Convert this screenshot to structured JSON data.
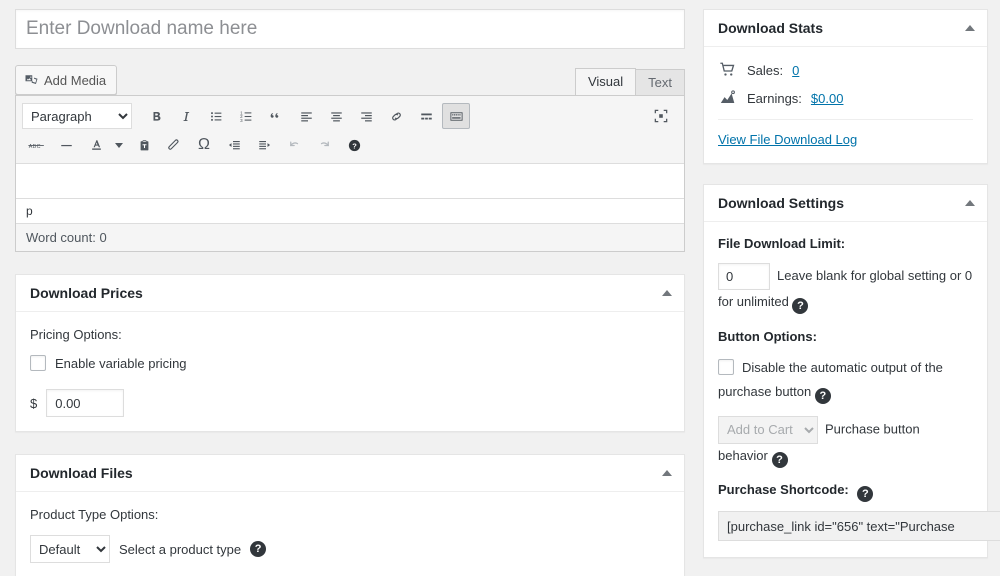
{
  "editor": {
    "title_placeholder": "Enter Download name here",
    "add_media_label": "Add Media",
    "tabs": [
      {
        "label": "Visual",
        "active": true
      },
      {
        "label": "Text",
        "active": false
      }
    ],
    "format_select": "Paragraph",
    "toolbar_row1": [
      {
        "name": "bold-icon",
        "title": "Bold"
      },
      {
        "name": "italic-icon",
        "title": "Italic"
      },
      {
        "name": "bulleted-list-icon",
        "title": "Bulleted list"
      },
      {
        "name": "numbered-list-icon",
        "title": "Numbered list"
      },
      {
        "name": "blockquote-icon",
        "title": "Blockquote"
      },
      {
        "name": "align-left-icon",
        "title": "Align left"
      },
      {
        "name": "align-center-icon",
        "title": "Align center"
      },
      {
        "name": "align-right-icon",
        "title": "Align right"
      },
      {
        "name": "link-icon",
        "title": "Insert/edit link"
      },
      {
        "name": "read-more-icon",
        "title": "Insert Read More tag"
      },
      {
        "name": "toolbar-toggle-icon",
        "title": "Toolbar Toggle"
      }
    ],
    "toolbar_row2": [
      {
        "name": "strikethrough-icon",
        "title": "Strikethrough"
      },
      {
        "name": "horizontal-rule-icon",
        "title": "Horizontal line"
      },
      {
        "name": "text-color-icon",
        "title": "Text color"
      },
      {
        "name": "text-color-caret-icon",
        "title": "Text color options"
      },
      {
        "name": "paste-as-text-icon",
        "title": "Paste as text"
      },
      {
        "name": "clear-formatting-icon",
        "title": "Clear formatting"
      },
      {
        "name": "special-character-icon",
        "title": "Special character"
      },
      {
        "name": "outdent-icon",
        "title": "Decrease indent"
      },
      {
        "name": "indent-icon",
        "title": "Increase indent"
      },
      {
        "name": "undo-icon",
        "title": "Undo"
      },
      {
        "name": "redo-icon",
        "title": "Redo"
      },
      {
        "name": "keyboard-help-icon",
        "title": "Keyboard Shortcuts"
      }
    ],
    "fullscreen_icon": "distraction-free-icon",
    "path": "p",
    "word_count": "Word count: 0"
  },
  "download_prices": {
    "panel_title": "Download Prices",
    "pricing_options_label": "Pricing Options:",
    "variable_pricing_label": "Enable variable pricing",
    "variable_pricing_checked": false,
    "currency_symbol": "$",
    "price_value": "0.00"
  },
  "download_files": {
    "panel_title": "Download Files",
    "product_type_label": "Product Type Options:",
    "product_type_value": "Default",
    "product_type_options": [
      "Default"
    ],
    "select_hint": "Select a product type"
  },
  "download_stats": {
    "panel_title": "Download Stats",
    "sales_label": "Sales:",
    "sales_value": "0",
    "earnings_label": "Earnings:",
    "earnings_value": "$0.00",
    "log_link": "View File Download Log"
  },
  "download_settings": {
    "panel_title": "Download Settings",
    "file_download_limit_label": "File Download Limit:",
    "file_download_limit_value": "0",
    "file_download_limit_hint": "Leave blank for global setting or 0 for unlimited",
    "button_options_label": "Button Options:",
    "disable_button_label": "Disable the automatic output of the purchase button",
    "disable_button_checked": false,
    "cart_behavior_value": "Add to Cart",
    "cart_behavior_options": [
      "Add to Cart"
    ],
    "cart_behavior_hint": "Purchase button behavior",
    "purchase_shortcode_label": "Purchase Shortcode:",
    "purchase_shortcode_value": "[purchase_link id=\"656\" text=\"Purchase"
  },
  "colors": {
    "page_bg": "#f1f1f1",
    "panel_bg": "#ffffff",
    "border": "#e5e5e5",
    "link": "#0073aa",
    "text": "#32373c"
  }
}
